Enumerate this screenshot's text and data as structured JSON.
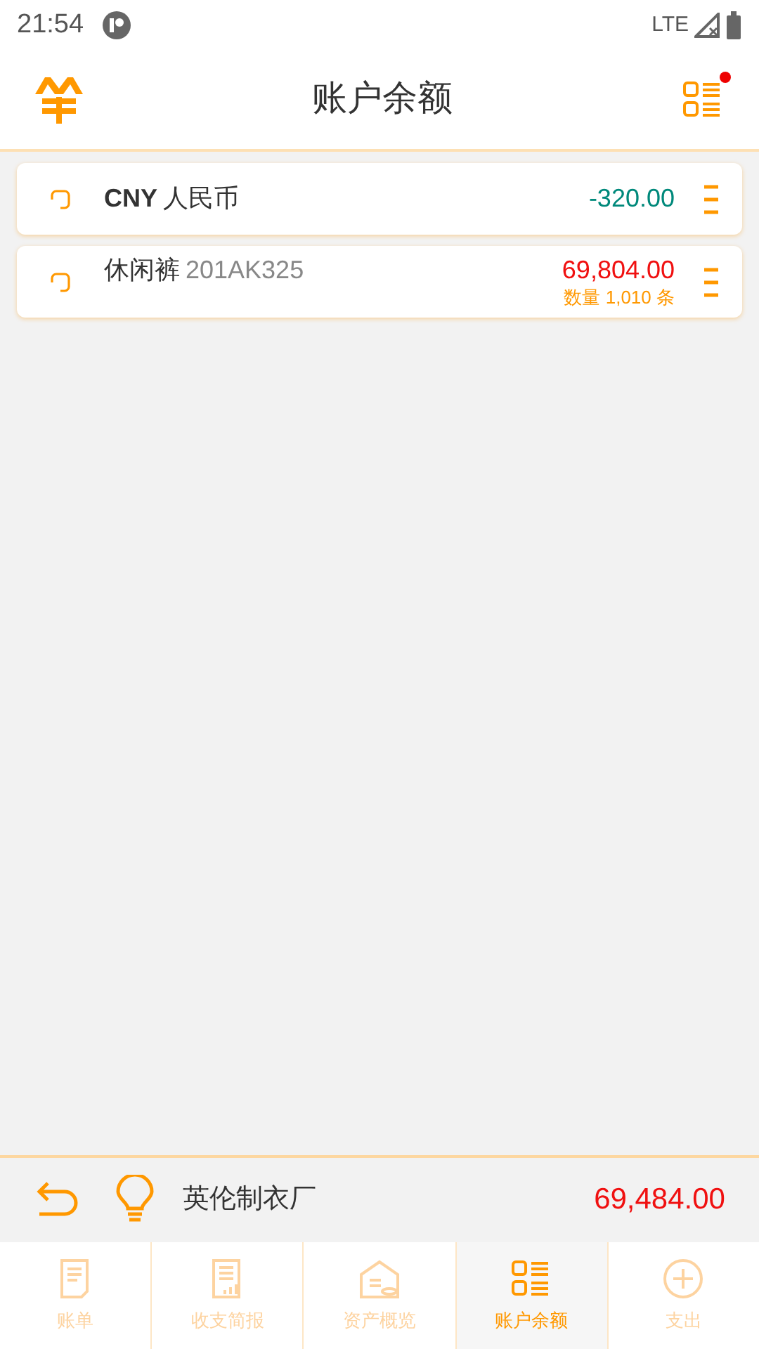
{
  "status_bar": {
    "time": "21:54",
    "network": "LTE"
  },
  "header": {
    "title": "账户余额",
    "notification": true
  },
  "accounts": [
    {
      "kind": "currency",
      "code": "CNY",
      "name": "人民币",
      "amount": "-320.00",
      "color": "#00897b"
    },
    {
      "kind": "item",
      "name": "休闲裤",
      "code": "201AK325",
      "amount": "69,804.00",
      "color": "#f01010",
      "detail": "数量 1,010 条"
    }
  ],
  "summary": {
    "company": "英伦制衣厂",
    "total": "69,484.00"
  },
  "tabs": [
    {
      "kind": "bill",
      "label": "账单",
      "selected": false
    },
    {
      "kind": "report",
      "label": "收支简报",
      "selected": false
    },
    {
      "kind": "assets",
      "label": "资产概览",
      "selected": false
    },
    {
      "kind": "balance",
      "label": "账户余额",
      "selected": true
    },
    {
      "kind": "add",
      "label": "支出",
      "selected": false
    }
  ]
}
